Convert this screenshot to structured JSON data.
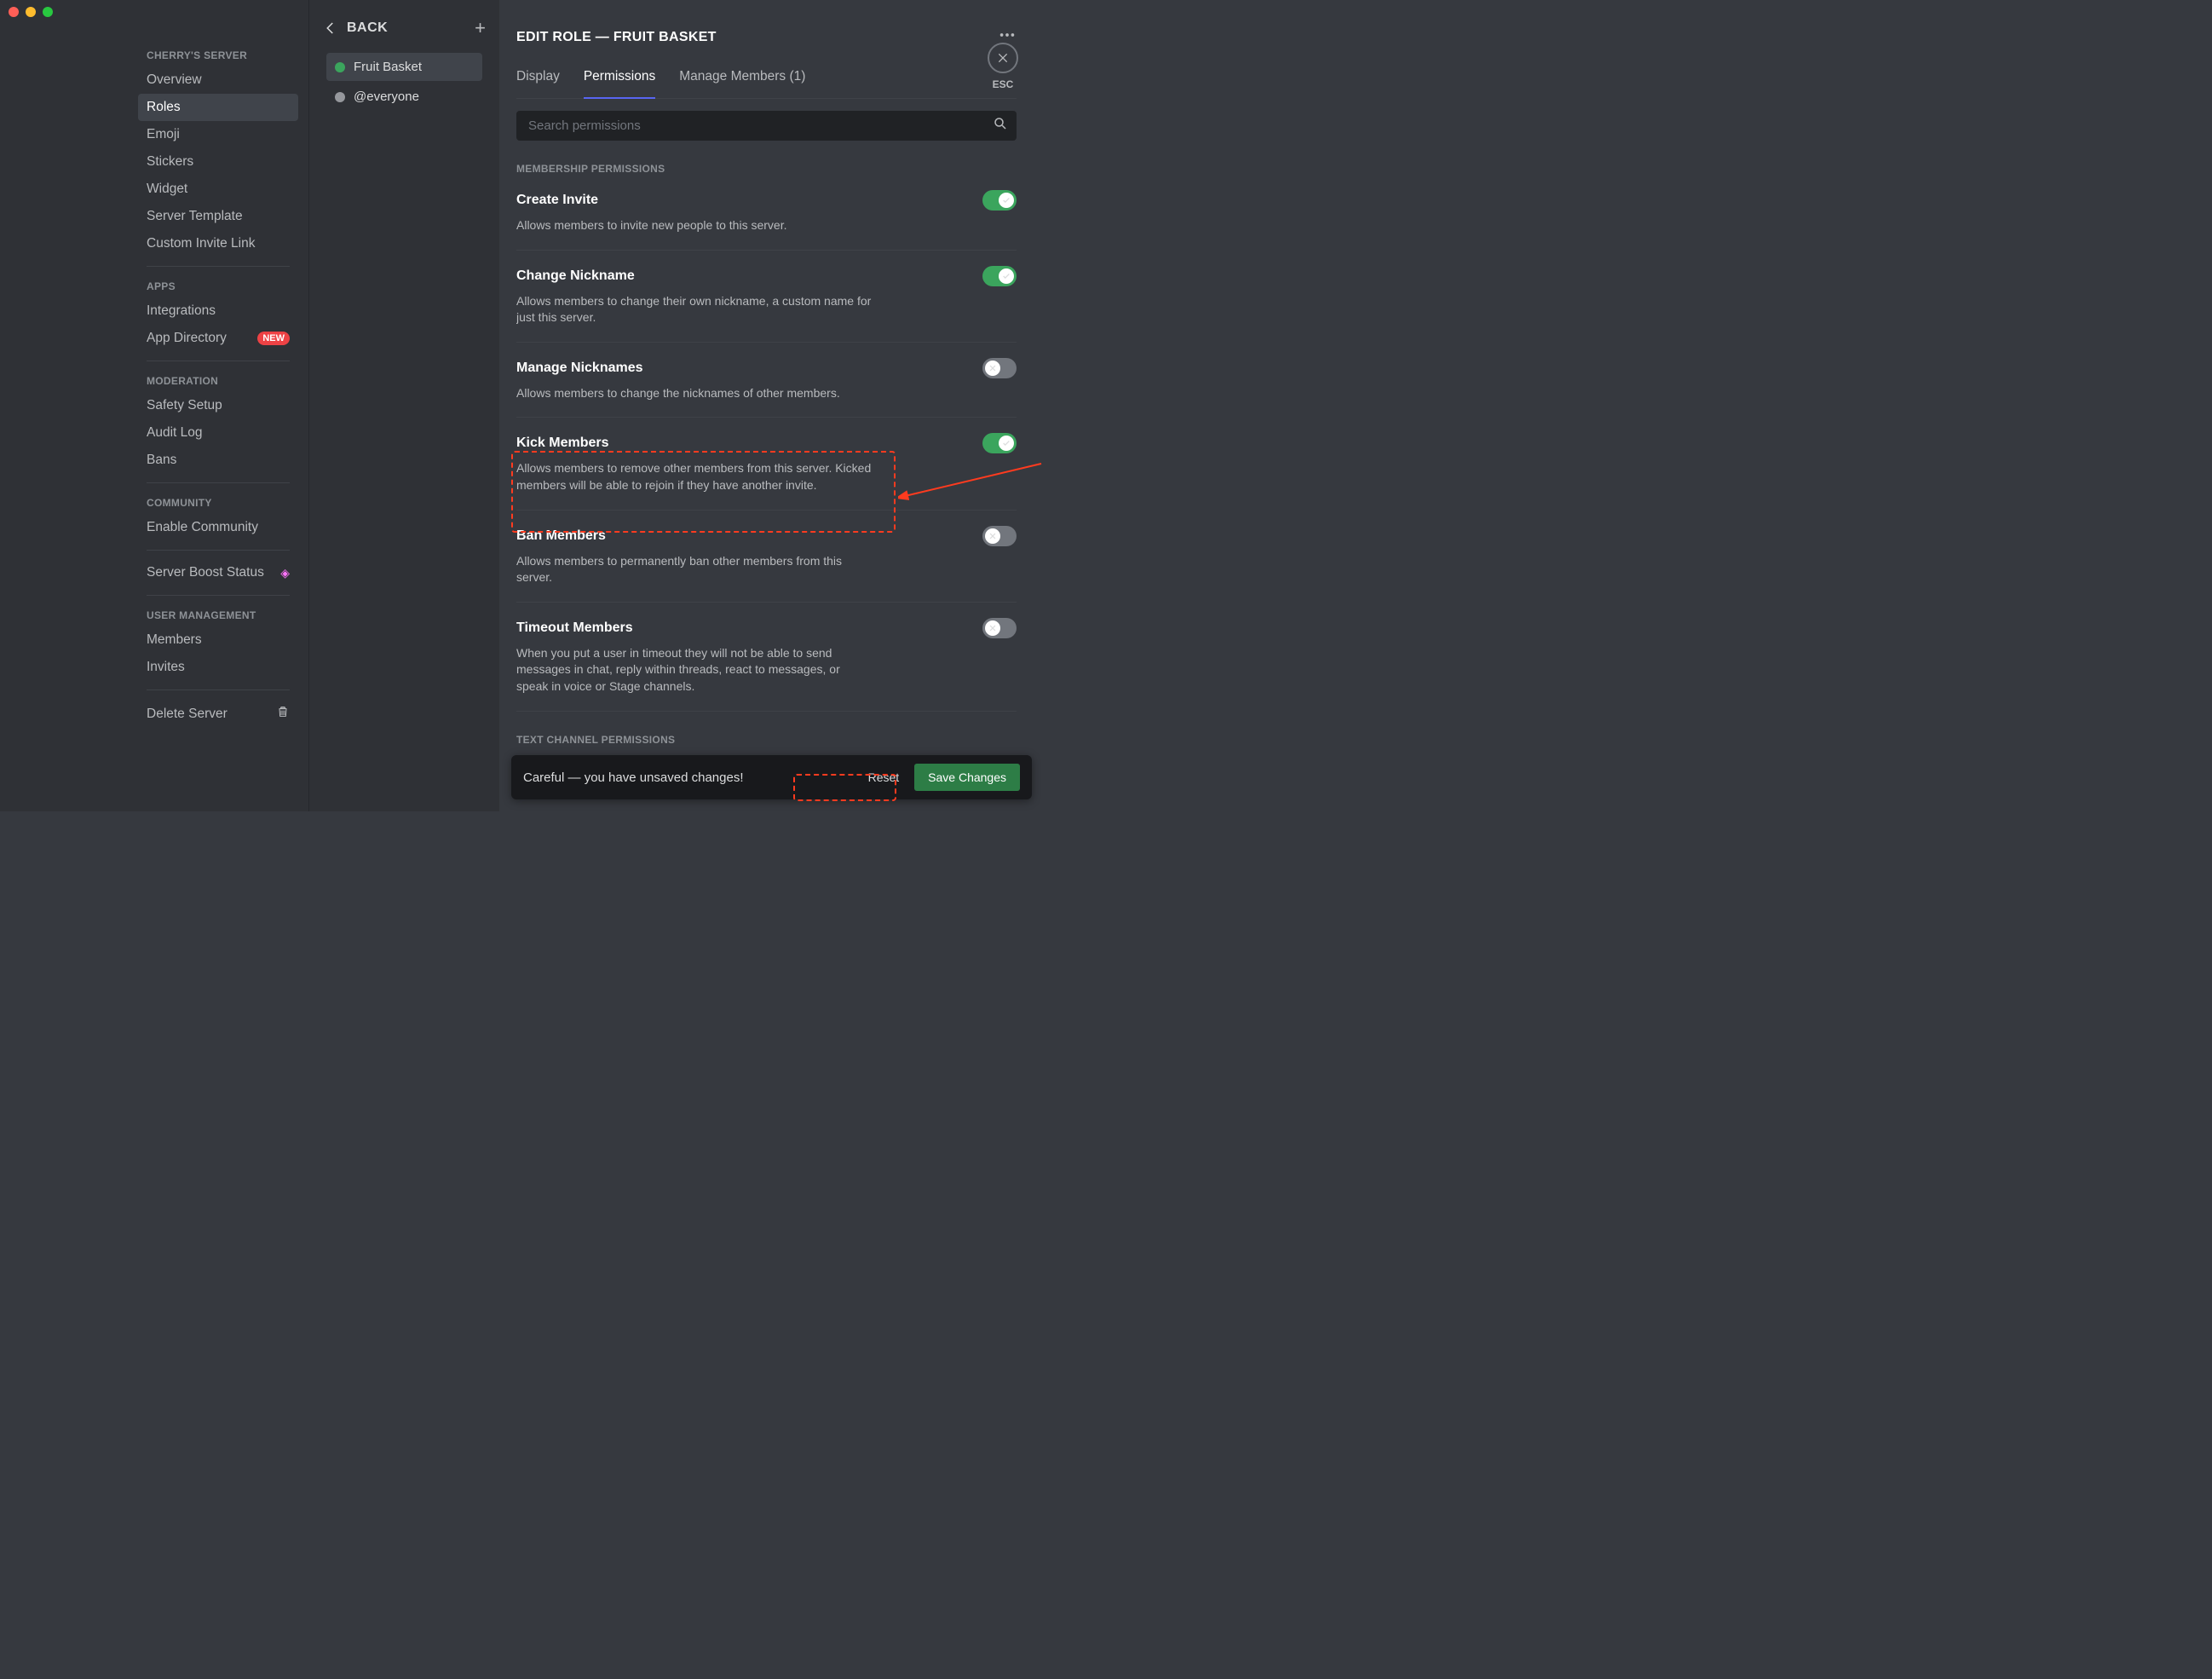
{
  "sidebar": {
    "server_name_header": "CHERRY'S SERVER",
    "items_main": [
      "Overview",
      "Roles",
      "Emoji",
      "Stickers",
      "Widget",
      "Server Template",
      "Custom Invite Link"
    ],
    "apps_header": "APPS",
    "items_apps": [
      "Integrations",
      "App Directory"
    ],
    "app_dir_badge": "NEW",
    "moderation_header": "MODERATION",
    "items_mod": [
      "Safety Setup",
      "Audit Log",
      "Bans"
    ],
    "community_header": "COMMUNITY",
    "items_community": [
      "Enable Community"
    ],
    "boost_label": "Server Boost Status",
    "usermgmt_header": "USER MANAGEMENT",
    "items_user": [
      "Members",
      "Invites"
    ],
    "delete_label": "Delete Server"
  },
  "roles_col": {
    "back_label": "BACK",
    "roles": [
      {
        "name": "Fruit Basket",
        "color": "green",
        "active": true
      },
      {
        "name": "@everyone",
        "color": "grey",
        "active": false
      }
    ]
  },
  "main": {
    "title": "EDIT ROLE — FRUIT BASKET",
    "tabs": [
      "Display",
      "Permissions",
      "Manage Members (1)"
    ],
    "search_placeholder": "Search permissions",
    "section1_header": "MEMBERSHIP PERMISSIONS",
    "section2_header": "TEXT CHANNEL PERMISSIONS",
    "perms": [
      {
        "title": "Create Invite",
        "desc": "Allows members to invite new people to this server.",
        "on": true
      },
      {
        "title": "Change Nickname",
        "desc": "Allows members to change their own nickname, a custom name for just this server.",
        "on": true
      },
      {
        "title": "Manage Nicknames",
        "desc": "Allows members to change the nicknames of other members.",
        "on": false
      },
      {
        "title": "Kick Members",
        "desc": "Allows members to remove other members from this server. Kicked members will be able to rejoin if they have another invite.",
        "on": true
      },
      {
        "title": "Ban Members",
        "desc": "Allows members to permanently ban other members from this server.",
        "on": false
      },
      {
        "title": "Timeout Members",
        "desc": "When you put a user in timeout they will not be able to send messages in chat, reply within threads, react to messages, or speak in voice or Stage channels.",
        "on": false
      }
    ],
    "esc_label": "ESC"
  },
  "savebar": {
    "msg": "Careful — you have unsaved changes!",
    "reset": "Reset",
    "save": "Save Changes"
  }
}
